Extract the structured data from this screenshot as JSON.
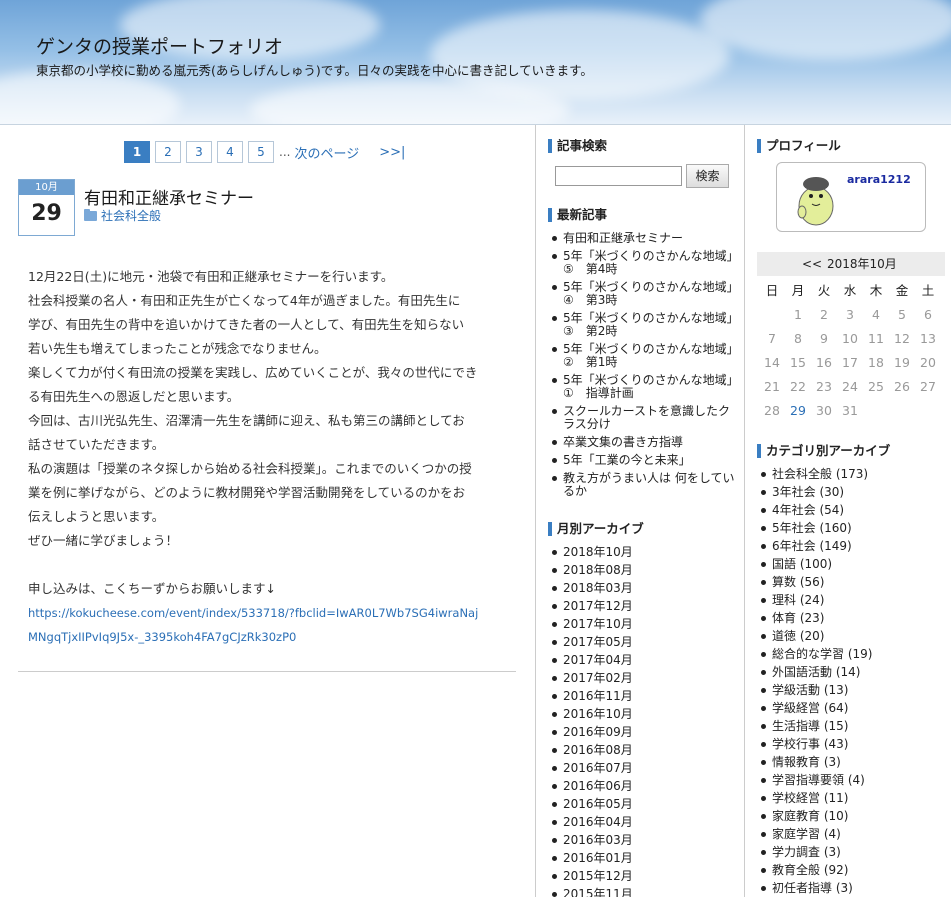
{
  "header": {
    "title": "ゲンタの授業ポートフォリオ",
    "description": "東京都の小学校に勤める嵐元秀(あらしげんしゅう)です。日々の実践を中心に書き記していきます。"
  },
  "pager": {
    "pages": [
      "1",
      "2",
      "3",
      "4",
      "5"
    ],
    "dots": "...",
    "next": "次のページ",
    "last": ">>|"
  },
  "post": {
    "month": "10月",
    "day": "29",
    "title": "有田和正継承セミナー",
    "category": "社会科全般",
    "lines": [
      "12月22日(土)に地元・池袋で有田和正継承セミナーを行います。",
      "社会科授業の名人・有田和正先生が亡くなって4年が過ぎました。有田先生に",
      "学び、有田先生の背中を追いかけてきた者の一人として、有田先生を知らない",
      "若い先生も増えてしまったことが残念でなりません。",
      "楽しくて力が付く有田流の授業を実践し、広めていくことが、我々の世代にでき",
      "る有田先生への恩返しだと思います。",
      "今回は、古川光弘先生、沼澤清一先生を講師に迎え、私も第三の講師としてお",
      "話させていただきます。",
      "私の演題は「授業のネタ探しから始める社会科授業」。これまでのいくつかの授",
      "業を例に挙げながら、どのように教材開発や学習活動開発をしているのかをお",
      "伝えしようと思います。",
      "ぜひ一緒に学びましょう！",
      "",
      "申し込みは、こくちーずからお願いします↓"
    ],
    "link_lines": [
      "https://kokucheese.com/event/index/533718/?fbclid=IwAR0L7Wb7SG4iwraNaj",
      "MNgqTjxIIPvIq9J5x-_3395koh4FA7gCJzRk30zP0"
    ]
  },
  "search": {
    "heading": "記事検索",
    "button": "検索"
  },
  "latest": {
    "heading": "最新記事",
    "items": [
      [
        "有田和正継承セミナー"
      ],
      [
        "5年「米づくりのさかんな地域」",
        "⑤　第4時"
      ],
      [
        "5年「米づくりのさかんな地域」",
        "④　第3時"
      ],
      [
        "5年「米づくりのさかんな地域」",
        "③　第2時"
      ],
      [
        "5年「米づくりのさかんな地域」",
        "②　第1時"
      ],
      [
        "5年「米づくりのさかんな地域」",
        "①　指導計画"
      ],
      [
        "スクールカーストを意識したク",
        "ラス分け"
      ],
      [
        "卒業文集の書き方指導"
      ],
      [
        "5年「工業の今と未来」"
      ],
      [
        "教え方がうまい人は 何をしてい",
        "るか"
      ]
    ]
  },
  "monthly": {
    "heading": "月別アーカイブ",
    "items": [
      "2018年10月",
      "2018年08月",
      "2018年03月",
      "2017年12月",
      "2017年10月",
      "2017年05月",
      "2017年04月",
      "2017年02月",
      "2016年11月",
      "2016年10月",
      "2016年09月",
      "2016年08月",
      "2016年07月",
      "2016年06月",
      "2016年05月",
      "2016年04月",
      "2016年03月",
      "2016年01月",
      "2015年12月",
      "2015年11月"
    ]
  },
  "profile": {
    "heading": "プロフィール",
    "name": "arara1212"
  },
  "calendar": {
    "prev": "<<",
    "title": "2018年10月",
    "weekdays": [
      "日",
      "月",
      "火",
      "水",
      "木",
      "金",
      "土"
    ],
    "start_offset": 1,
    "days": 31,
    "linked_day": 29
  },
  "categories": {
    "heading": "カテゴリ別アーカイブ",
    "items": [
      "社会科全般 (173)",
      "3年社会 (30)",
      "4年社会 (54)",
      "5年社会 (160)",
      "6年社会 (149)",
      "国語 (100)",
      "算数 (56)",
      "理科 (24)",
      "体育 (23)",
      "道徳 (20)",
      "総合的な学習 (19)",
      "外国語活動 (14)",
      "学級活動 (13)",
      "学級経営 (64)",
      "生活指導 (15)",
      "学校行事 (43)",
      "情報教育 (3)",
      "学習指導要領 (4)",
      "学校経営 (11)",
      "家庭教育 (10)",
      "家庭学習 (4)",
      "学力調査 (3)",
      "教育全般 (92)",
      "初任者指導 (3)"
    ]
  },
  "colors": {
    "accent": "#3a7ec2",
    "link": "#2b6fb6"
  }
}
